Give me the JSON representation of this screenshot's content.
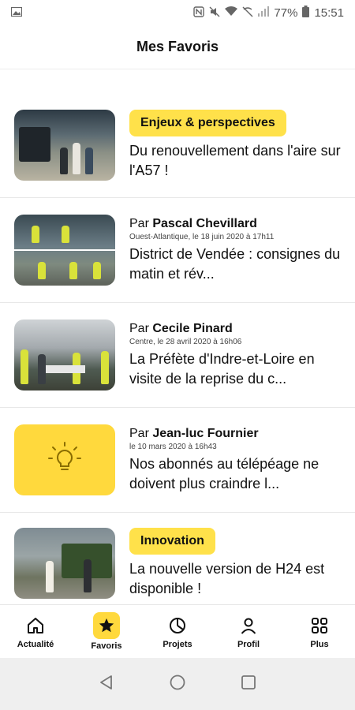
{
  "status_bar": {
    "battery": "77%",
    "time": "15:51"
  },
  "header": {
    "title": "Mes Favoris"
  },
  "cards": [
    {
      "type": "tag",
      "tag": "Enjeux & perspectives",
      "title": "Du renouvellement dans l'aire sur l'A57 !"
    },
    {
      "type": "author",
      "by": "Par",
      "author": "Pascal Chevillard",
      "meta": "Ouest-Atlantique, le 18 juin 2020 à 17h11",
      "title": "District de Vendée  : consignes du matin et rév..."
    },
    {
      "type": "author",
      "by": "Par",
      "author": "Cecile Pinard",
      "meta": "Centre, le 28 avril 2020 à 16h06",
      "title": "La Préfète d'Indre-et-Loire en visite de la reprise du c..."
    },
    {
      "type": "author",
      "by": "Par",
      "author": "Jean-luc Fournier",
      "meta": "le 10 mars 2020 à 16h43",
      "title": "Nos abonnés au télépéage ne doivent plus craindre l..."
    },
    {
      "type": "tag",
      "tag": "Innovation",
      "title": "La nouvelle version de H24 est disponible !"
    }
  ],
  "bottom_nav": [
    {
      "label": "Actualité",
      "icon": "home-icon",
      "active": false
    },
    {
      "label": "Favoris",
      "icon": "star-icon",
      "active": true
    },
    {
      "label": "Projets",
      "icon": "pie-chart-icon",
      "active": false
    },
    {
      "label": "Profil",
      "icon": "person-icon",
      "active": false
    },
    {
      "label": "Plus",
      "icon": "grid-icon",
      "active": false
    }
  ],
  "colors": {
    "accent": "#ffd93d",
    "tag_bg": "#ffe14a"
  }
}
